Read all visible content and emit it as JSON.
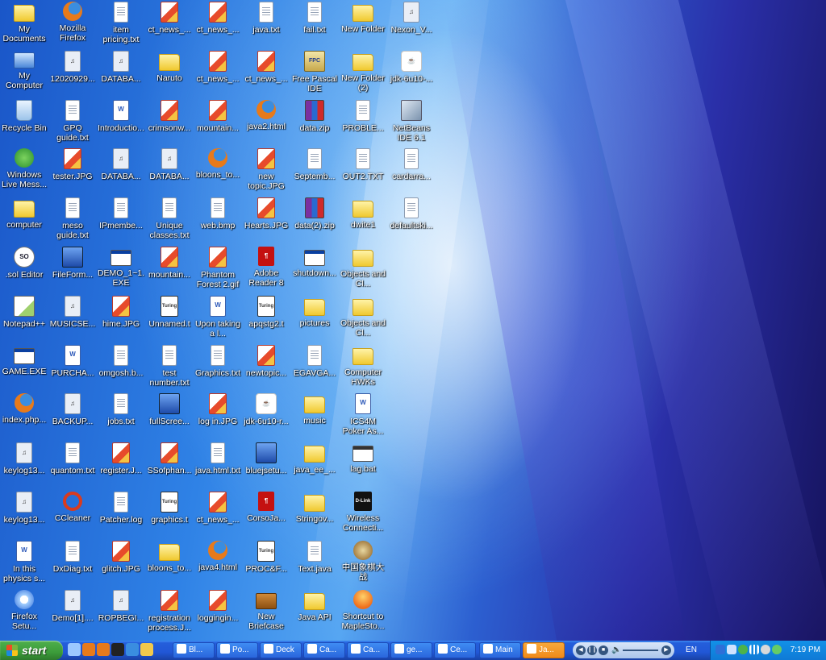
{
  "desktop": {
    "columns": [
      [
        {
          "label": "My Documents",
          "icon": "folder-icon",
          "kind": "folder"
        },
        {
          "label": "My Computer",
          "icon": "computer-icon",
          "kind": "computer"
        },
        {
          "label": "Recycle Bin",
          "icon": "recycle-bin-icon",
          "kind": "bin"
        },
        {
          "label": "Windows Live Mess...",
          "icon": "msn-icon",
          "kind": "msn"
        },
        {
          "label": "computer",
          "icon": "folder-icon",
          "kind": "folder"
        },
        {
          "label": ".sol Editor",
          "icon": "sol-editor-icon",
          "kind": "sol"
        },
        {
          "label": "Notepad++",
          "icon": "notepad-icon",
          "kind": "notepad"
        },
        {
          "label": "GAME.EXE",
          "icon": "exe-icon",
          "kind": "exe"
        },
        {
          "label": "index.php...",
          "icon": "firefox-icon",
          "kind": "ff"
        },
        {
          "label": "keylog13...",
          "icon": "media-icon",
          "kind": "media"
        },
        {
          "label": "keylog13...",
          "icon": "media-icon",
          "kind": "media"
        },
        {
          "label": "In this physics s...",
          "icon": "word-doc-icon",
          "kind": "word"
        },
        {
          "label": "Firefox Setu...",
          "icon": "setup-icon",
          "kind": "setup"
        }
      ],
      [
        {
          "label": "Mozilla Firefox",
          "icon": "firefox-icon",
          "kind": "ff"
        },
        {
          "label": "12020929...",
          "icon": "mp3-icon",
          "kind": "media"
        },
        {
          "label": "GPQ guide.txt",
          "icon": "text-file-icon",
          "kind": "doc"
        },
        {
          "label": "tester.JPG",
          "icon": "image-icon",
          "kind": "img"
        },
        {
          "label": "meso guide.txt",
          "icon": "text-file-icon",
          "kind": "doc"
        },
        {
          "label": "FileForm...",
          "icon": "network-icon",
          "kind": "network"
        },
        {
          "label": "MUSICSE...",
          "icon": "media-icon",
          "kind": "media"
        },
        {
          "label": "PURCHA...",
          "icon": "word-doc-icon",
          "kind": "word"
        },
        {
          "label": "BACKUP...",
          "icon": "media-icon",
          "kind": "media"
        },
        {
          "label": "quantom.txt",
          "icon": "text-file-icon",
          "kind": "doc"
        },
        {
          "label": "CCleaner",
          "icon": "ccleaner-icon",
          "kind": "cleaner"
        },
        {
          "label": "DxDiag.txt",
          "icon": "text-file-icon",
          "kind": "doc"
        },
        {
          "label": "Demo[1]....",
          "icon": "media-icon",
          "kind": "media"
        }
      ],
      [
        {
          "label": "item pricing.txt",
          "icon": "text-file-icon",
          "kind": "doc"
        },
        {
          "label": "DATABA...",
          "icon": "media-icon",
          "kind": "media"
        },
        {
          "label": "Introductio...",
          "icon": "word-doc-icon",
          "kind": "word"
        },
        {
          "label": "DATABA...",
          "icon": "media-icon",
          "kind": "media"
        },
        {
          "label": "IPmembe...",
          "icon": "text-file-icon",
          "kind": "doc"
        },
        {
          "label": "DEMO_1~1.EXE",
          "icon": "exe-icon",
          "kind": "exe"
        },
        {
          "label": "hime.JPG",
          "icon": "image-icon",
          "kind": "img"
        },
        {
          "label": "omgosh.b...",
          "icon": "bitmap-icon",
          "kind": "doc"
        },
        {
          "label": "jobs.txt",
          "icon": "text-file-icon",
          "kind": "doc"
        },
        {
          "label": "register.J...",
          "icon": "image-icon",
          "kind": "img"
        },
        {
          "label": "Patcher.log",
          "icon": "text-file-icon",
          "kind": "doc"
        },
        {
          "label": "glitch.JPG",
          "icon": "image-icon",
          "kind": "img"
        },
        {
          "label": "ROPBEGI...",
          "icon": "media-icon",
          "kind": "media"
        }
      ],
      [
        {
          "label": "ct_news_...",
          "icon": "image-icon",
          "kind": "img"
        },
        {
          "label": "Naruto",
          "icon": "folder-icon",
          "kind": "folder"
        },
        {
          "label": "crimsonw...",
          "icon": "image-icon",
          "kind": "img"
        },
        {
          "label": "DATABA...",
          "icon": "media-icon",
          "kind": "media"
        },
        {
          "label": "Unique classes.txt",
          "icon": "text-file-icon",
          "kind": "doc"
        },
        {
          "label": "mountain...",
          "icon": "image-icon",
          "kind": "img"
        },
        {
          "label": "Unnamed.t",
          "icon": "turing-icon",
          "kind": "turing"
        },
        {
          "label": "test number.txt",
          "icon": "text-file-icon",
          "kind": "doc"
        },
        {
          "label": "fullScree...",
          "icon": "tetris-icon",
          "kind": "network"
        },
        {
          "label": "SSofphan...",
          "icon": "image-icon",
          "kind": "img"
        },
        {
          "label": "graphics.t",
          "icon": "turing-icon",
          "kind": "turing"
        },
        {
          "label": "bloons_to...",
          "icon": "folder-icon",
          "kind": "folder"
        },
        {
          "label": "registration process.J...",
          "icon": "image-icon",
          "kind": "img"
        }
      ],
      [
        {
          "label": "ct_news_...",
          "icon": "image-icon",
          "kind": "img"
        },
        {
          "label": "ct_news_...",
          "icon": "image-icon",
          "kind": "img"
        },
        {
          "label": "mountain...",
          "icon": "image-icon",
          "kind": "img"
        },
        {
          "label": "bloons_to...",
          "icon": "firefox-icon",
          "kind": "ff"
        },
        {
          "label": "web.bmp",
          "icon": "bitmap-icon",
          "kind": "doc"
        },
        {
          "label": "Phantom Forest 2.gif",
          "icon": "image-icon",
          "kind": "img"
        },
        {
          "label": "Upon taking a l...",
          "icon": "word-doc-icon",
          "kind": "word"
        },
        {
          "label": "Graphics.txt",
          "icon": "text-file-icon",
          "kind": "doc"
        },
        {
          "label": "log in.JPG",
          "icon": "image-icon",
          "kind": "img"
        },
        {
          "label": "java.html.txt",
          "icon": "text-file-icon",
          "kind": "doc"
        },
        {
          "label": "ct_news_...",
          "icon": "image-icon",
          "kind": "img"
        },
        {
          "label": "java4.html",
          "icon": "firefox-icon",
          "kind": "ff"
        },
        {
          "label": "loggingin...",
          "icon": "image-icon",
          "kind": "img"
        }
      ],
      [
        {
          "label": "java.txt",
          "icon": "text-file-icon",
          "kind": "doc"
        },
        {
          "label": "ct_news_...",
          "icon": "image-icon",
          "kind": "img"
        },
        {
          "label": "java2.html",
          "icon": "firefox-icon",
          "kind": "ff"
        },
        {
          "label": "new topic.JPG",
          "icon": "image-icon",
          "kind": "img"
        },
        {
          "label": "Hearts.JPG",
          "icon": "image-icon",
          "kind": "img"
        },
        {
          "label": "Adobe Reader 8",
          "icon": "pdf-icon",
          "kind": "pdf"
        },
        {
          "label": "apqstg2.t",
          "icon": "turing-icon",
          "kind": "turing"
        },
        {
          "label": "newtopic...",
          "icon": "image-icon",
          "kind": "img"
        },
        {
          "label": "jdk-6u10-r...",
          "icon": "java-icon",
          "kind": "java"
        },
        {
          "label": "bluejsetu...",
          "icon": "setup-icon",
          "kind": "network"
        },
        {
          "label": "CorsoJa...",
          "icon": "pdf-icon",
          "kind": "pdf"
        },
        {
          "label": "PROC&F...",
          "icon": "turing-icon",
          "kind": "turing"
        },
        {
          "label": "New Briefcase",
          "icon": "briefcase-icon",
          "kind": "briefcase"
        }
      ],
      [
        {
          "label": "fail.txt",
          "icon": "text-file-icon",
          "kind": "doc"
        },
        {
          "label": "Free Pascal IDE",
          "icon": "pascal-icon",
          "kind": "pascal"
        },
        {
          "label": "data.zip",
          "icon": "zip-icon",
          "kind": "zip"
        },
        {
          "label": "Septemb...",
          "icon": "text-file-icon",
          "kind": "doc"
        },
        {
          "label": "data(2).zip",
          "icon": "zip-icon",
          "kind": "zip"
        },
        {
          "label": "shutdown...",
          "icon": "exe-icon",
          "kind": "exe"
        },
        {
          "label": "pictures",
          "icon": "folder-icon",
          "kind": "folder"
        },
        {
          "label": "EGAVGA...",
          "icon": "bitmap-icon",
          "kind": "doc"
        },
        {
          "label": "music",
          "icon": "folder-icon",
          "kind": "folder"
        },
        {
          "label": "java_ee_...",
          "icon": "folder-icon",
          "kind": "folder"
        },
        {
          "label": "Stringov...",
          "icon": "folder-icon",
          "kind": "folder"
        },
        {
          "label": "Text.java",
          "icon": "text-file-icon",
          "kind": "doc"
        },
        {
          "label": "Java API",
          "icon": "folder-icon",
          "kind": "folder"
        }
      ],
      [
        {
          "label": "New Folder",
          "icon": "folder-icon",
          "kind": "folder"
        },
        {
          "label": "New Folder (2)",
          "icon": "folder-icon",
          "kind": "folder"
        },
        {
          "label": "PROBLE...",
          "icon": "text-file-icon",
          "kind": "doc"
        },
        {
          "label": "OUT2.TXT",
          "icon": "text-file-icon",
          "kind": "doc"
        },
        {
          "label": "dwite1",
          "icon": "folder-icon",
          "kind": "folder"
        },
        {
          "label": "Objects and Cl...",
          "icon": "folder-icon",
          "kind": "folder"
        },
        {
          "label": "Objects and Cl...",
          "icon": "folder-icon",
          "kind": "folder"
        },
        {
          "label": "Computer HWKs",
          "icon": "folder-icon",
          "kind": "folder"
        },
        {
          "label": "ICS4M Poker As...",
          "icon": "word-doc-icon",
          "kind": "word"
        },
        {
          "label": "lag.bat",
          "icon": "bat-icon",
          "kind": "bat"
        },
        {
          "label": "Wireless Connecti...",
          "icon": "dlink-icon",
          "kind": "dlink"
        },
        {
          "label": "中国象棋大战",
          "icon": "chess-icon",
          "kind": "chess"
        },
        {
          "label": "Shortcut to MapleSto...",
          "icon": "maplestory-icon",
          "kind": "maple"
        }
      ],
      [
        {
          "label": "Nexon_V...",
          "icon": "mp3-icon",
          "kind": "media"
        },
        {
          "label": "jdk-6u10-...",
          "icon": "java-icon",
          "kind": "java"
        },
        {
          "label": "NetBeans IDE 6.1",
          "icon": "netbeans-icon",
          "kind": "netbeans"
        },
        {
          "label": "cardarra...",
          "icon": "text-file-icon",
          "kind": "doc"
        },
        {
          "label": "defaultski...",
          "icon": "text-file-icon",
          "kind": "doc"
        }
      ]
    ]
  },
  "taskbar": {
    "start_label": "start",
    "quick_launch": [
      "show-desktop-icon",
      "firefox-icon",
      "firefox-icon",
      "command-prompt-icon",
      "ie-icon",
      "explorer-icon"
    ],
    "tasks": [
      {
        "label": "Bl...",
        "icon": "window-icon",
        "active": false
      },
      {
        "label": "Po...",
        "icon": "firefox-icon",
        "active": false
      },
      {
        "label": "Deck",
        "icon": "window-icon",
        "active": false
      },
      {
        "label": "Ca...",
        "icon": "window-icon",
        "active": false
      },
      {
        "label": "Ca...",
        "icon": "window-icon",
        "active": false
      },
      {
        "label": "ge...",
        "icon": "java-icon",
        "active": false
      },
      {
        "label": "Ce...",
        "icon": "java-icon",
        "active": false
      },
      {
        "label": "Main",
        "icon": "window-icon",
        "active": false
      },
      {
        "label": "Ja...",
        "icon": "java-icon",
        "active": true
      }
    ],
    "language": "EN",
    "clock": "7:19 PM"
  }
}
